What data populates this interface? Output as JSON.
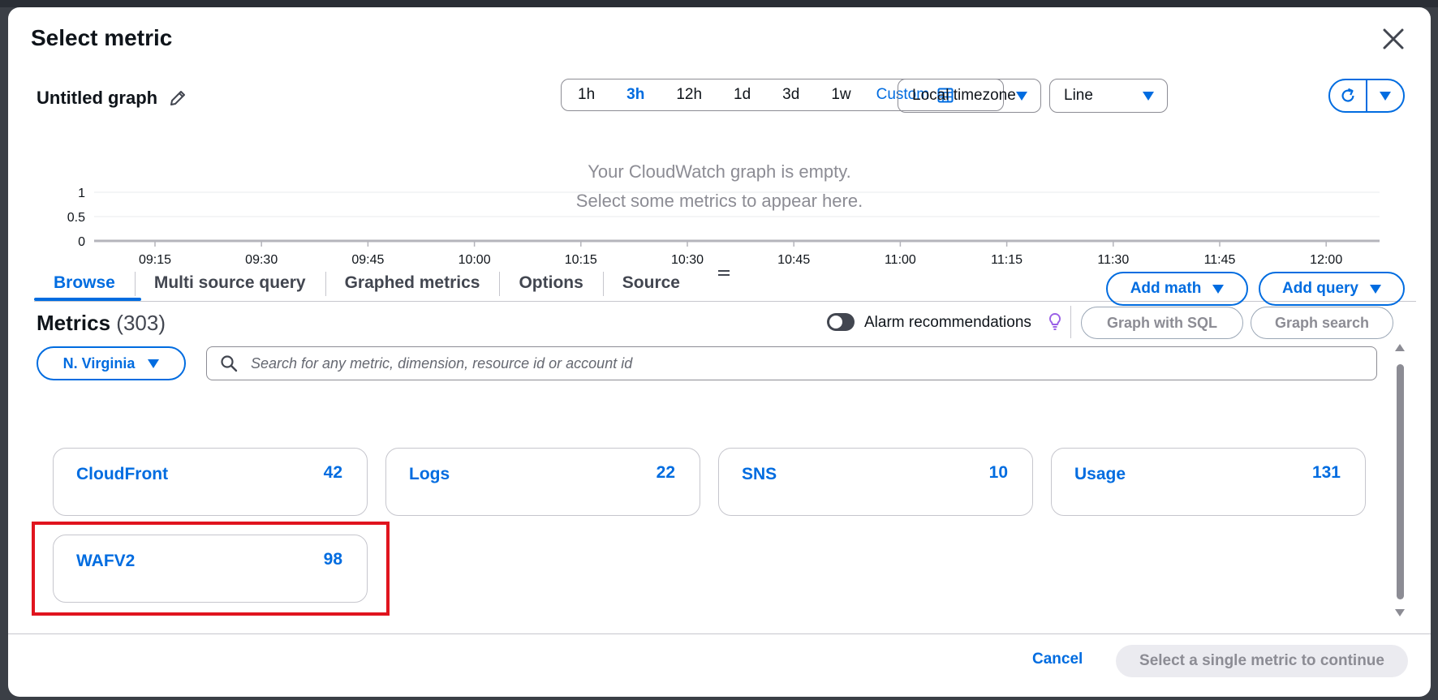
{
  "modal": {
    "title": "Select metric"
  },
  "graph": {
    "title": "Untitled graph"
  },
  "time_ranges": [
    "1h",
    "3h",
    "12h",
    "1d",
    "3d",
    "1w"
  ],
  "time_range_active": "3h",
  "custom_label": "Custom",
  "timezone": {
    "value": "Local timezone"
  },
  "graph_type": {
    "value": "Line"
  },
  "chart": {
    "y_ticks": [
      "1",
      "0.5",
      "0"
    ],
    "x_ticks": [
      "09:15",
      "09:30",
      "09:45",
      "10:00",
      "10:15",
      "10:30",
      "10:45",
      "11:00",
      "11:15",
      "11:30",
      "11:45",
      "12:00"
    ],
    "empty_line1": "Your CloudWatch graph is empty.",
    "empty_line2": "Select some metrics to appear here."
  },
  "tabs": [
    {
      "label": "Browse"
    },
    {
      "label": "Multi source query"
    },
    {
      "label": "Graphed metrics"
    },
    {
      "label": "Options"
    },
    {
      "label": "Source"
    }
  ],
  "actions": {
    "add_math": "Add math",
    "add_query": "Add query"
  },
  "metrics": {
    "heading": "Metrics",
    "count": "(303)"
  },
  "alarm_recommendations": {
    "label": "Alarm recommendations"
  },
  "graph_with_sql": "Graph with SQL",
  "graph_search": "Graph search",
  "region": "N. Virginia",
  "search": {
    "placeholder": "Search for any metric, dimension, resource id or account id",
    "value": ""
  },
  "namespaces": [
    {
      "name": "CloudFront",
      "count": "42"
    },
    {
      "name": "Logs",
      "count": "22"
    },
    {
      "name": "SNS",
      "count": "10"
    },
    {
      "name": "Usage",
      "count": "131"
    },
    {
      "name": "WAFV2",
      "count": "98"
    }
  ],
  "footer": {
    "cancel": "Cancel",
    "continue": "Select a single metric to continue"
  },
  "colors": {
    "accent": "#006ce0",
    "highlight": "#e0141e",
    "muted": "#8c8c94"
  }
}
